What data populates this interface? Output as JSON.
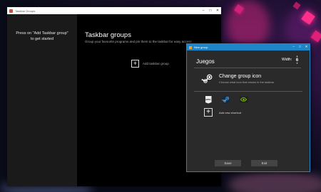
{
  "main_window": {
    "title": "Taskbar Groups",
    "controls": {
      "minimize": "–",
      "maximize": "□",
      "close": "✕"
    },
    "sidebar": {
      "message": "Press on \"Add Taskbar group\" to get started"
    },
    "content": {
      "title": "Taskbar groups",
      "subtitle": "Group your favourite programs and pin them to the taskbar for easy access",
      "add_group_label": "Add taskbar group"
    }
  },
  "dialog": {
    "title": "New group",
    "controls": {
      "minimize": "–",
      "maximize": "□",
      "close": "✕"
    },
    "group_name": "Juegos",
    "width_label": "Width:",
    "width_value": "6",
    "change_icon": {
      "title": "Change group icon",
      "subtitle": "Choose what icon that shows in the taskbar"
    },
    "shortcuts": [
      "epic-games-icon",
      "steam-icon",
      "nvidia-icon"
    ],
    "epic_logo_text": "EPIC",
    "add_shortcut_label": "Add new shortcut",
    "save_label": "Save",
    "exit_label": "Exit"
  },
  "colors": {
    "dialog_accent": "#1e86c8",
    "main_background": "#000000",
    "sidebar_background": "#1a1a1a",
    "dialog_background": "#2a2a2a"
  }
}
